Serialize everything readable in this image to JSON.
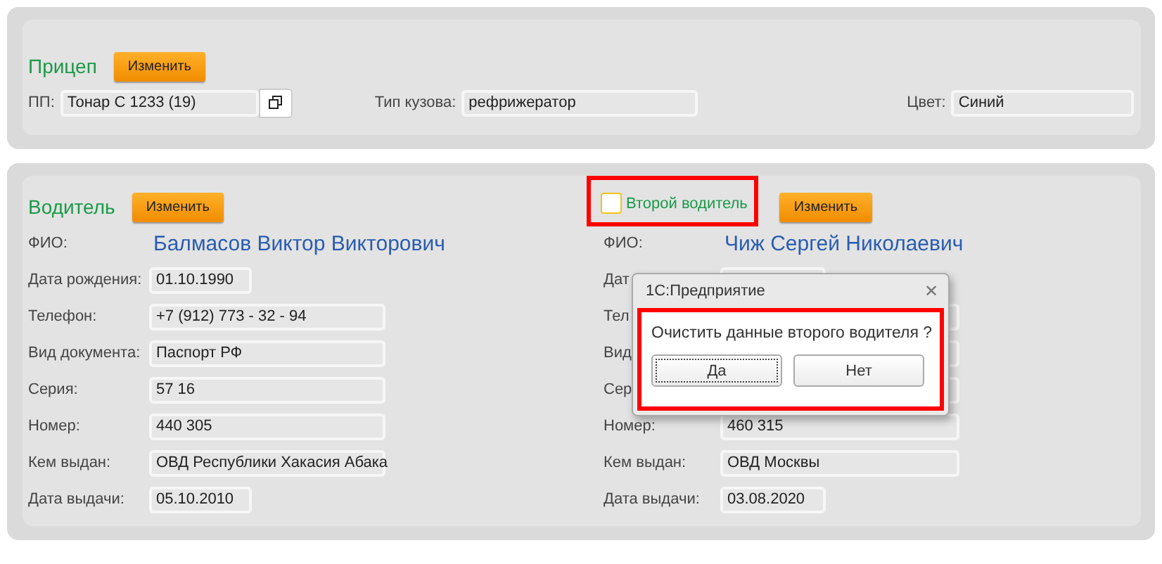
{
  "trailer": {
    "title": "Прицеп",
    "edit_button": "Изменить",
    "fields": [
      {
        "kind": "lookup",
        "label": "ПП:",
        "value": "Тонар С 1233 (19)"
      },
      {
        "kind": "text",
        "label": "Тип кузова:",
        "value": "рефрижератор"
      },
      {
        "kind": "text",
        "label": "Цвет:",
        "value": "Синий"
      }
    ]
  },
  "drivers": [
    {
      "kind": "primary",
      "title": "Водитель",
      "edit_button": "Изменить",
      "name_label": "ФИО:",
      "name": "Балмасов Виктор Викторович",
      "rows": [
        {
          "kind": "short",
          "label": "Дата рождения:",
          "value": "01.10.1990"
        },
        {
          "kind": "long",
          "label": "Телефон:",
          "value": "+7 (912) 773 - 32 - 94"
        },
        {
          "kind": "long",
          "label": "Вид документа:",
          "value": "Паспорт РФ"
        },
        {
          "kind": "long",
          "label": "Серия:",
          "value": "57 16"
        },
        {
          "kind": "long",
          "label": "Номер:",
          "value": "440 305"
        },
        {
          "kind": "long",
          "label": "Кем выдан:",
          "value": "ОВД Республики Хакасия Абака"
        },
        {
          "kind": "short",
          "label": "Дата выдачи:",
          "value": "05.10.2010"
        }
      ]
    },
    {
      "kind": "second",
      "checkbox": {
        "label": "Второй водитель",
        "checked": false
      },
      "edit_button": "Изменить",
      "name_label": "ФИО:",
      "name": "Чиж Сергей Николаевич",
      "rows": [
        {
          "kind": "short",
          "label": "Дат"
        },
        {
          "kind": "long",
          "label": "Тел"
        },
        {
          "kind": "long",
          "label": "Вид"
        },
        {
          "kind": "long",
          "label": "Сер"
        },
        {
          "kind": "long",
          "label": "Номер:",
          "value": "460 315"
        },
        {
          "kind": "long",
          "label": "Кем выдан:",
          "value": "ОВД Москвы"
        },
        {
          "kind": "short",
          "label": "Дата выдачи:",
          "value": "03.08.2020"
        }
      ]
    }
  ],
  "dialog": {
    "title": "1С:Предприятие",
    "close": "✕",
    "message": "Очистить данные второго водителя ?",
    "buttons": [
      {
        "label": "Да",
        "focused": true
      },
      {
        "label": "Нет",
        "focused": false
      }
    ]
  }
}
